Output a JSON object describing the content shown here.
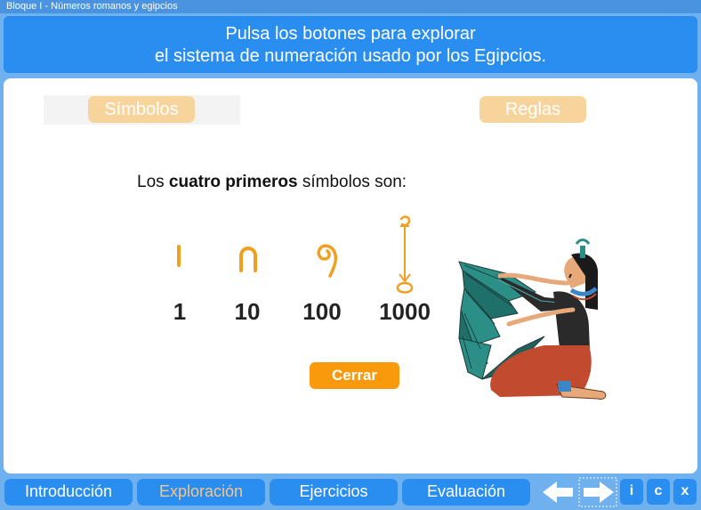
{
  "window": {
    "title": "Bloque I - Números romanos y egipcios"
  },
  "header": {
    "line1": "Pulsa los botones para explorar",
    "line2": "el sistema de numeración usado por los Egipcios."
  },
  "tabs": {
    "simbolos": "Símbolos",
    "reglas": "Reglas"
  },
  "content": {
    "intro_before": "Los ",
    "intro_bold": "cuatro primeros",
    "intro_after": " símbolos son:",
    "symbols": [
      {
        "icon": "stroke-icon",
        "value": "1"
      },
      {
        "icon": "heel-bone-icon",
        "value": "10"
      },
      {
        "icon": "coiled-rope-icon",
        "value": "100"
      },
      {
        "icon": "lotus-flower-icon",
        "value": "1000"
      }
    ],
    "close_label": "Cerrar"
  },
  "nav": {
    "items": [
      "Introducción",
      "Exploración",
      "Ejercicios",
      "Evaluación"
    ],
    "active": "Exploración",
    "info": "i",
    "credits": "c",
    "exit": "x"
  },
  "colors": {
    "header_bg": "#2a8ef0",
    "symbol_color": "#f0a020",
    "active_nav_text": "#f6c48c",
    "close_button": "#f89a0c"
  }
}
